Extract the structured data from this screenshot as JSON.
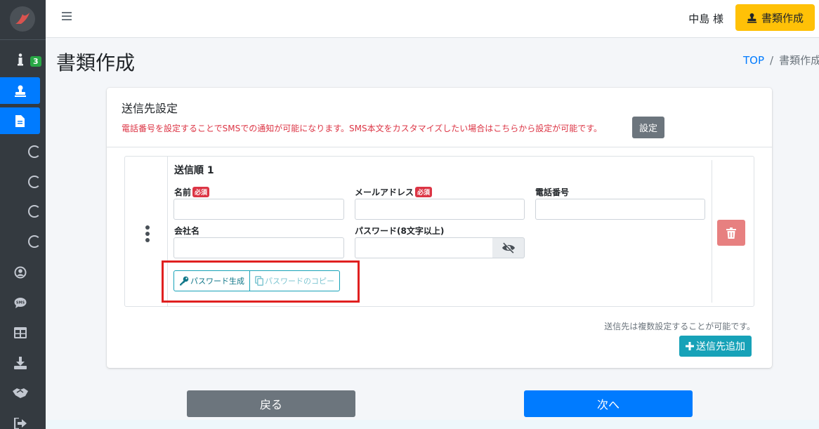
{
  "sidebar": {
    "info_badge": "3",
    "items": [
      {
        "icon": "info-icon"
      },
      {
        "icon": "stamp-icon"
      },
      {
        "icon": "document-icon"
      },
      {
        "icon": "circle-icon"
      },
      {
        "icon": "circle-icon"
      },
      {
        "icon": "circle-icon"
      },
      {
        "icon": "circle-icon"
      },
      {
        "icon": "user-circle-icon"
      },
      {
        "icon": "sms-icon"
      },
      {
        "icon": "table-icon"
      },
      {
        "icon": "download-icon"
      },
      {
        "icon": "handshake-icon"
      },
      {
        "icon": "sign-out-icon"
      }
    ]
  },
  "topbar": {
    "user_name": "中島 様",
    "create_doc_label": "書類作成"
  },
  "page": {
    "title": "書類作成",
    "breadcrumb": {
      "home": "TOP",
      "separator": "/",
      "current": "書類作成"
    }
  },
  "card": {
    "title": "送信先設定",
    "note": "電話番号を設定することでSMSでの通知が可能になります。SMS本文をカスタマイズしたい場合はこちらから設定が可能です。",
    "settings_button": "設定",
    "recipient": {
      "title": "送信順 1",
      "required_badge": "必須",
      "name_label": "名前",
      "email_label": "メールアドレス",
      "phone_label": "電話番号",
      "company_label": "会社名",
      "password_label": "パスワード(8文字以上)",
      "name_value": "",
      "email_value": "",
      "phone_value": "",
      "company_value": "",
      "password_value": "",
      "generate_password": "パスワード生成",
      "copy_password": "パスワードのコピー"
    },
    "multi_note": "送信先は複数設定することが可能です。",
    "add_recipient": "送信先追加"
  },
  "footer": {
    "back": "戻る",
    "next": "次へ"
  },
  "colors": {
    "primary": "#007bff",
    "warning": "#ffc107",
    "info": "#17a2b8",
    "danger": "#dc3545",
    "secondary": "#6c757d",
    "highlight": "#e02020"
  }
}
